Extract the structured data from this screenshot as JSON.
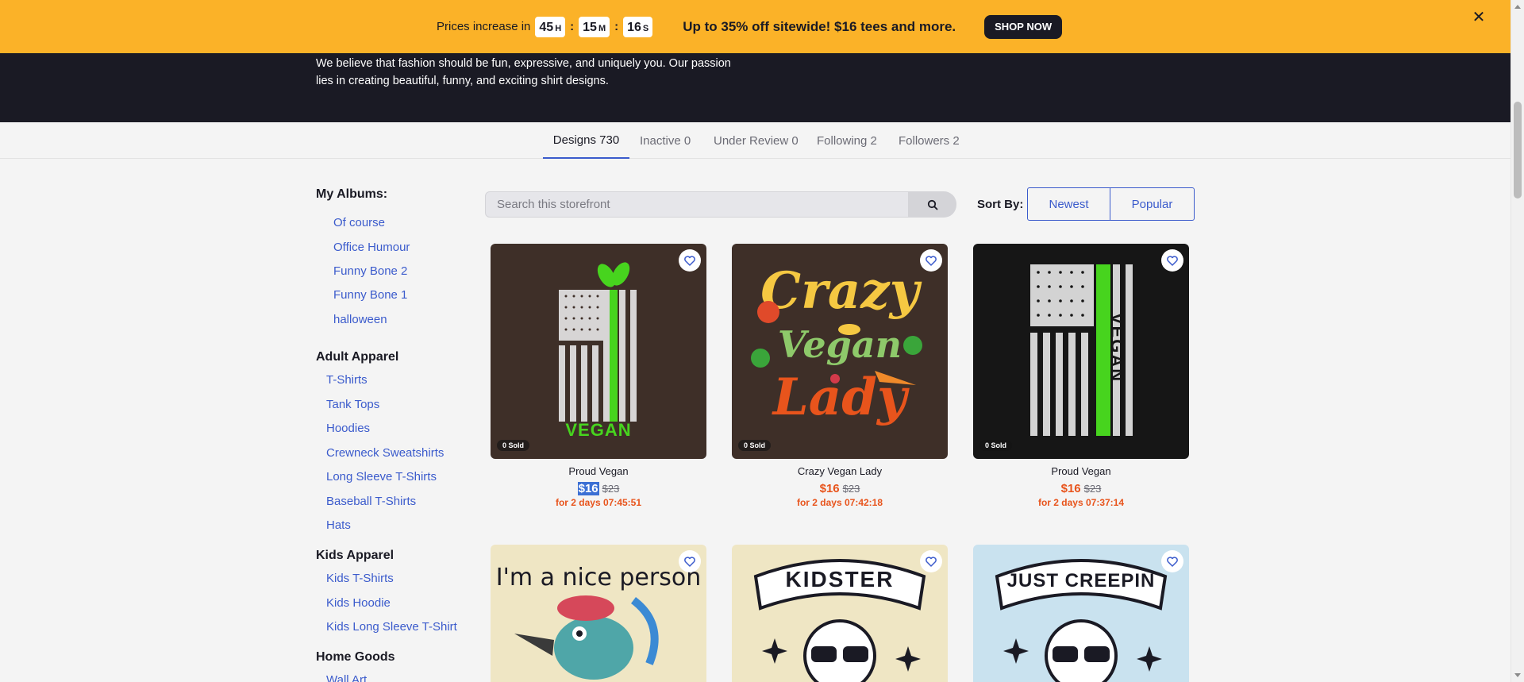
{
  "promo": {
    "prefix": "Prices increase in",
    "hours": "45",
    "hours_unit": "H",
    "minutes": "15",
    "minutes_unit": "M",
    "seconds": "16",
    "seconds_unit": "S",
    "separator": ":",
    "message": "Up to 35% off sitewide! $16 tees and more.",
    "cta": "SHOP NOW"
  },
  "hero": {
    "description": "We believe that fashion should be fun, expressive, and uniquely you. Our passion lies in creating beautiful, funny, and exciting shirt designs."
  },
  "tabs": [
    {
      "label": "Designs 730"
    },
    {
      "label": "Inactive 0"
    },
    {
      "label": "Under Review 0"
    },
    {
      "label": "Following 2"
    },
    {
      "label": "Followers 2"
    }
  ],
  "sidebar": {
    "albums_heading": "My Albums:",
    "albums": [
      "Of course",
      "Office Humour",
      "Funny Bone 2",
      "Funny Bone 1",
      "halloween"
    ],
    "adult_heading": "Adult Apparel",
    "adult": [
      "T-Shirts",
      "Tank Tops",
      "Hoodies",
      "Crewneck Sweatshirts",
      "Long Sleeve T-Shirts",
      "Baseball T-Shirts",
      "Hats"
    ],
    "kids_heading": "Kids Apparel",
    "kids": [
      "Kids T-Shirts",
      "Kids Hoodie",
      "Kids Long Sleeve T-Shirt"
    ],
    "home_heading": "Home Goods",
    "home": [
      "Wall Art"
    ]
  },
  "search": {
    "placeholder": "Search this storefront"
  },
  "sort": {
    "label": "Sort By:",
    "options": [
      "Newest",
      "Popular"
    ]
  },
  "products": [
    {
      "name": "Proud Vegan",
      "price": "$16",
      "was": "$23",
      "timer": "for 2 days 07:45:51",
      "sold": "0 Sold",
      "art_text": "VEGAN"
    },
    {
      "name": "Crazy Vegan Lady",
      "price": "$16",
      "was": "$23",
      "timer": "for 2 days 07:42:18",
      "sold": "0 Sold",
      "art_line1": "Crazy",
      "art_line2": "Vegan",
      "art_line3": "Lady"
    },
    {
      "name": "Proud Vegan",
      "price": "$16",
      "was": "$23",
      "timer": "for 2 days 07:37:14",
      "sold": "0 Sold",
      "art_text": "VEGAN"
    },
    {
      "art_text": "I'm a nice person"
    },
    {
      "art_text": "KIDSTER"
    },
    {
      "art_text": "JUST CREEPIN"
    }
  ],
  "colors": {
    "accent": "#3b5bcc",
    "promo": "#fbb228",
    "dark": "#1a1a24",
    "sale": "#e8541c"
  }
}
